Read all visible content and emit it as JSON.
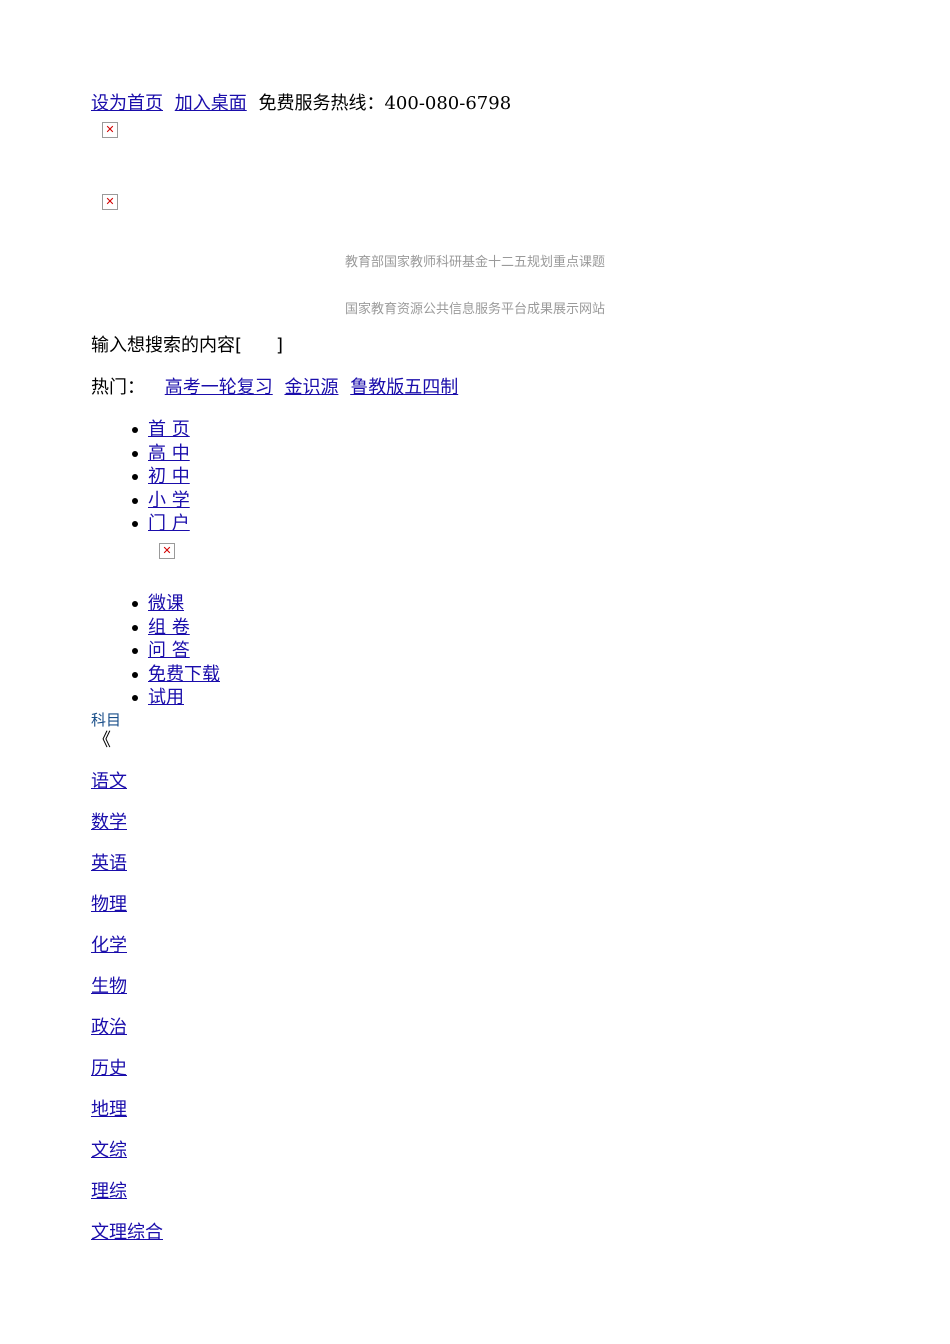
{
  "top_bar": {
    "set_home": "设为首页",
    "add_desktop": "加入桌面",
    "hotline": "免费服务热线：400-080-6798"
  },
  "slogans": {
    "line1": "教育部国家教师科研基金十二五规划重点课题",
    "line2": "国家教育资源公共信息服务平台成果展示网站"
  },
  "search": {
    "placeholder": "输入想搜索的内容[",
    "bracket_close": "]"
  },
  "hot": {
    "label": "热门：",
    "links": [
      "高考一轮复习",
      "金识源",
      "鲁教版五四制"
    ]
  },
  "nav_main": [
    "首 页",
    "高 中",
    "初 中",
    "小 学",
    "门 户"
  ],
  "nav_secondary": [
    "微课",
    "组 卷",
    "问 答",
    "免费下载",
    "试用"
  ],
  "subjects": {
    "title": "科目",
    "arrow": "《",
    "items": [
      "语文",
      "数学",
      "英语",
      "物理",
      "化学",
      "生物",
      "政治",
      "历史",
      "地理",
      "文综",
      "理综",
      "文理综合"
    ]
  },
  "icons": {
    "broken_image": "broken-image-icon"
  },
  "colors": {
    "link": "#1a0dab",
    "slogan": "#9a9a9a",
    "broken_x": "#d40000"
  }
}
